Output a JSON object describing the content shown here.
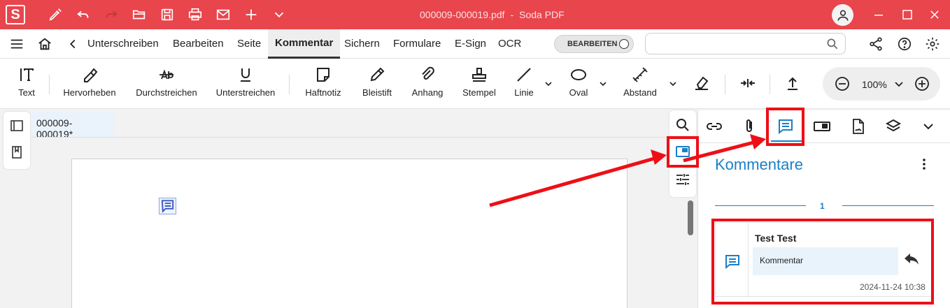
{
  "app": {
    "logo_letter": "S",
    "file_name": "000009-000019.pdf",
    "separator": "-",
    "app_name": "Soda PDF",
    "brand_color": "#e9454c"
  },
  "titlebar_icons": [
    "pen-icon",
    "undo-icon",
    "redo-icon",
    "open-folder-icon",
    "save-icon",
    "print-icon",
    "email-icon",
    "new-plus-icon",
    "more-chevron-icon"
  ],
  "menu": {
    "items": [
      {
        "label": "Unterschreiben"
      },
      {
        "label": "Bearbeiten"
      },
      {
        "label": "Seite"
      },
      {
        "label": "Kommentar",
        "active": true
      },
      {
        "label": "Sichern"
      },
      {
        "label": "Formulare"
      },
      {
        "label": "E-Sign"
      },
      {
        "label": "OCR"
      }
    ],
    "toggle_label": "BEARBEITEN",
    "search_placeholder": ""
  },
  "toolbar": {
    "tools": [
      {
        "label": "Text",
        "icon": "text-cursor-icon"
      },
      {
        "label": "Hervorheben",
        "icon": "highlighter-icon"
      },
      {
        "label": "Durchstreichen",
        "icon": "strikethrough-icon"
      },
      {
        "label": "Unterstreichen",
        "icon": "underline-icon"
      },
      {
        "label": "Haftnotiz",
        "icon": "sticky-note-icon"
      },
      {
        "label": "Bleistift",
        "icon": "pencil-icon"
      },
      {
        "label": "Anhang",
        "icon": "paperclip-icon"
      },
      {
        "label": "Stempel",
        "icon": "stamp-icon"
      },
      {
        "label": "Linie",
        "icon": "line-icon"
      },
      {
        "label": "Oval",
        "icon": "oval-icon"
      },
      {
        "label": "Abstand",
        "icon": "distance-icon"
      }
    ],
    "zoom_value": "100%"
  },
  "document": {
    "tab_title": "000009-000019*"
  },
  "panel": {
    "title": "Kommentare",
    "count": "1",
    "accent": "#1a7fc7",
    "comment": {
      "author": "Test Test",
      "text": "Kommentar",
      "date": "2024-11-24 10:38"
    }
  },
  "highlight_color": "#ee0f16"
}
